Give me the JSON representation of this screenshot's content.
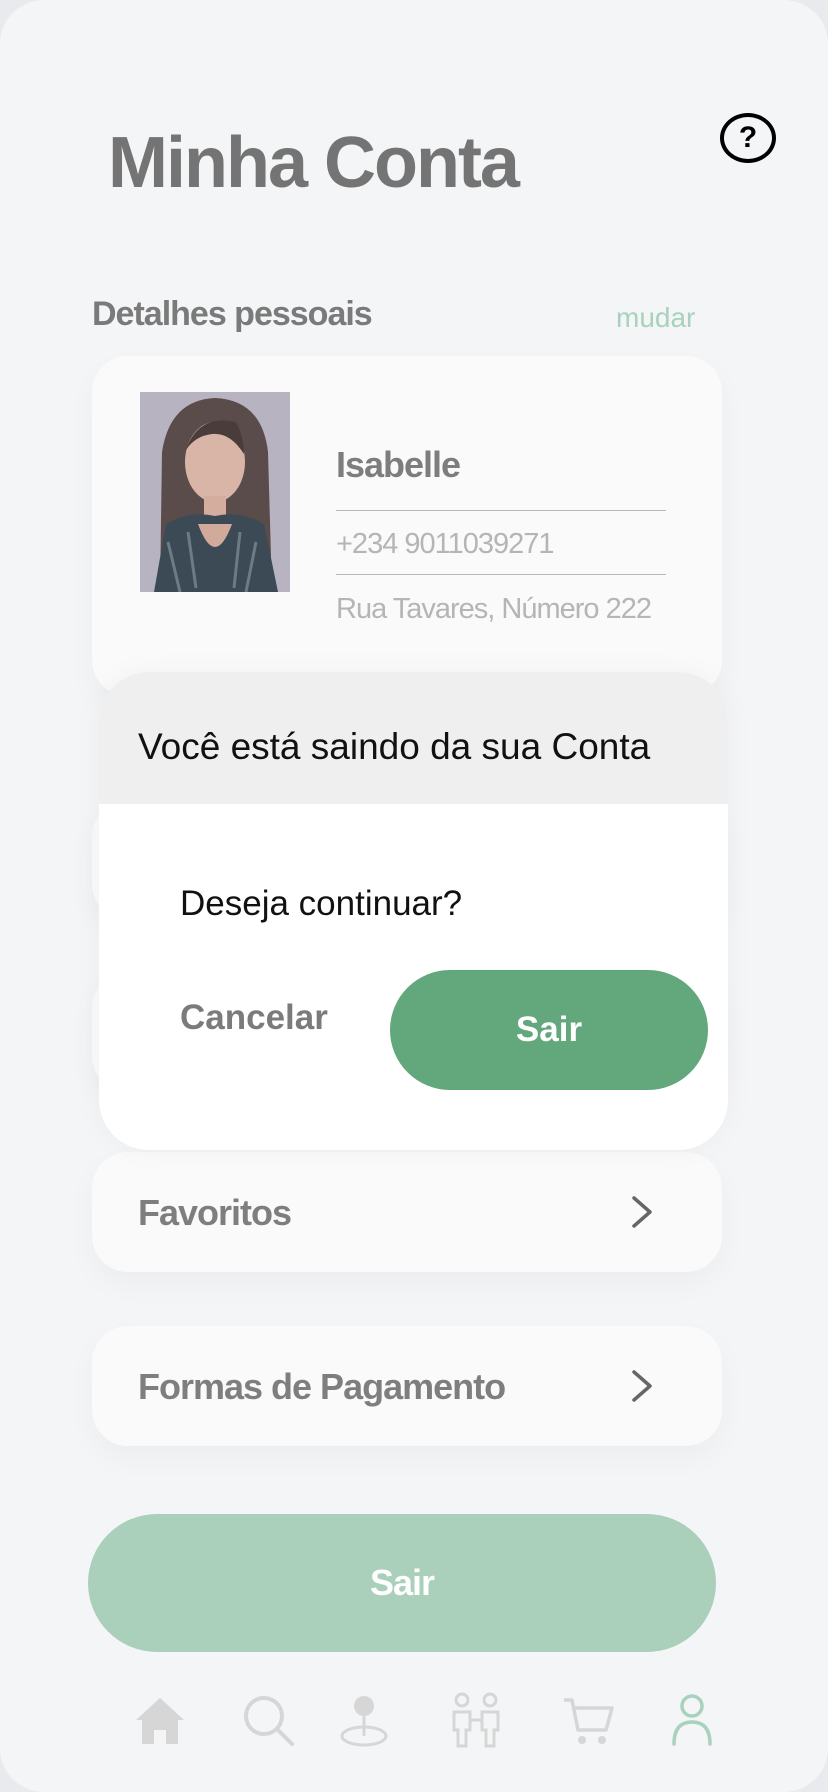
{
  "header": {
    "title": "Minha Conta",
    "help_icon": "question-circle-icon"
  },
  "personal": {
    "section_label": "Detalhes pessoais",
    "change_label": "mudar",
    "name": "Isabelle",
    "phone": "+234 9011039271",
    "address": "Rua Tavares, Número 222"
  },
  "menu": {
    "items": [
      {
        "label": "Favoritos",
        "icon": "chevron-right-icon"
      },
      {
        "label": "Formas de Pagamento",
        "icon": "chevron-right-icon"
      }
    ]
  },
  "logout_label": "Sair",
  "bottom_nav": {
    "items": [
      {
        "icon": "home-icon"
      },
      {
        "icon": "search-icon"
      },
      {
        "icon": "location-pin-icon"
      },
      {
        "icon": "people-icon"
      },
      {
        "icon": "cart-icon"
      },
      {
        "icon": "profile-icon",
        "active": true
      }
    ]
  },
  "dialog": {
    "title": "Você está saindo da sua Conta",
    "question": "Deseja continuar?",
    "cancel_label": "Cancelar",
    "confirm_label": "Sair"
  },
  "colors": {
    "accent": "#63a87c",
    "accent_faded": "#aacfbb",
    "background": "#f4f5f7",
    "active_nav": "#a8d2bd"
  }
}
